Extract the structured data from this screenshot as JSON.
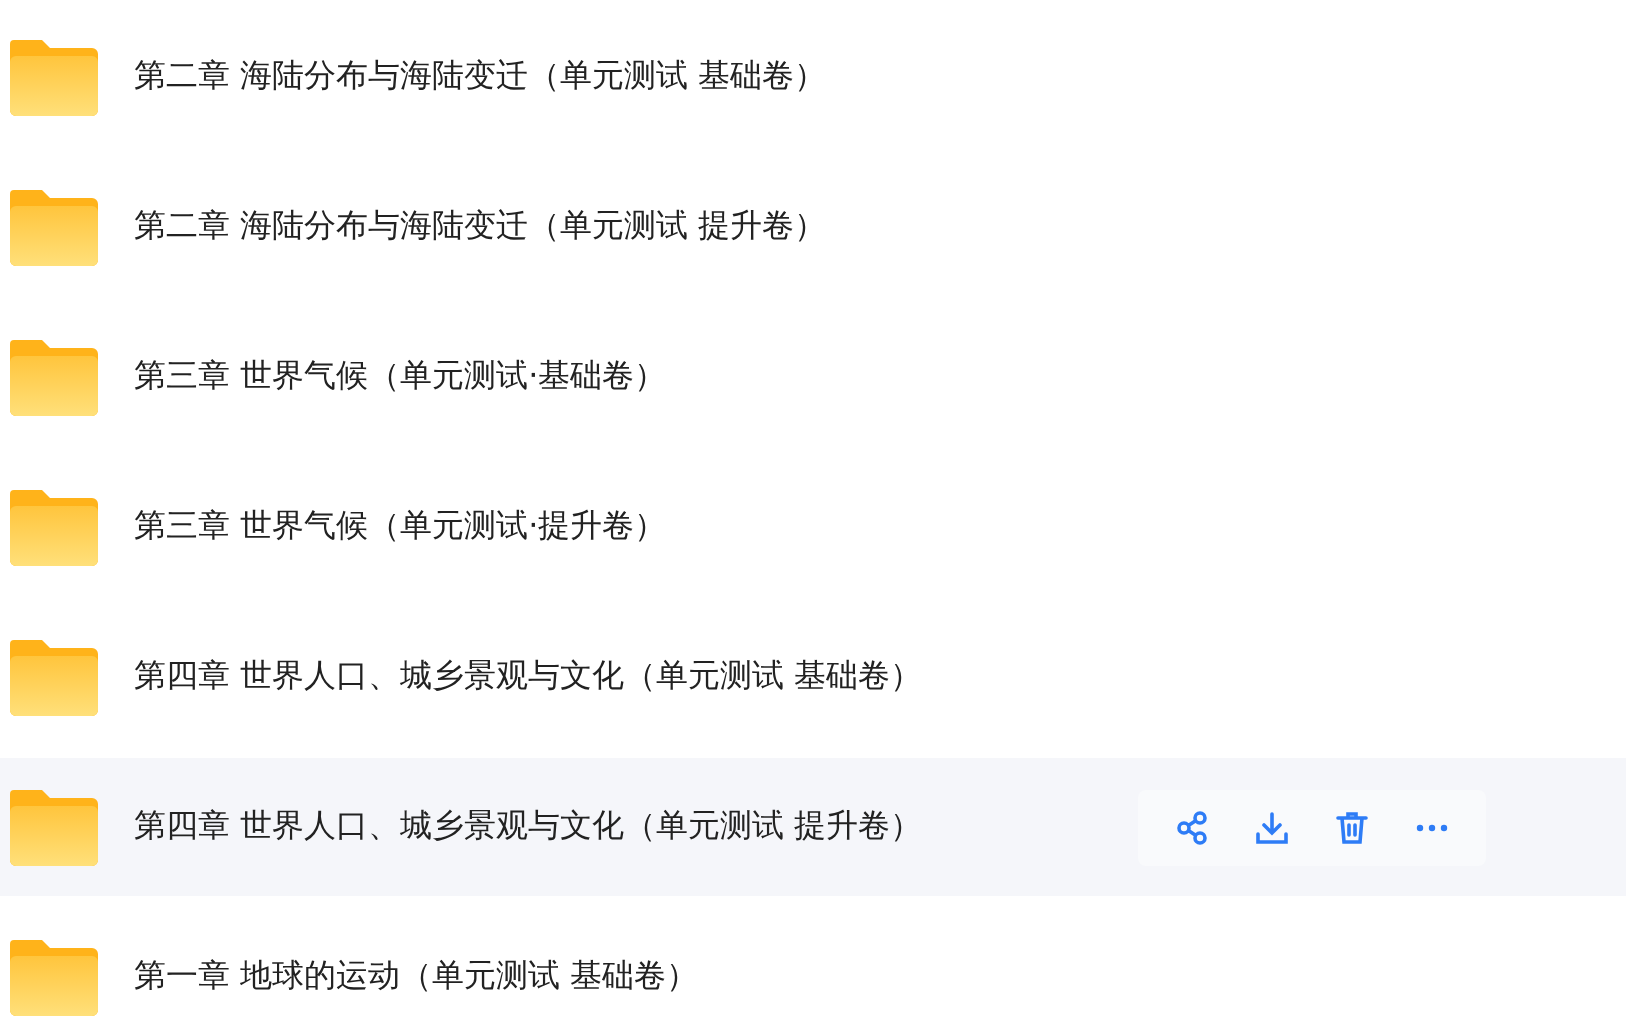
{
  "files": [
    {
      "name": "第二章 海陆分布与海陆变迁（单元测试 基础卷）",
      "hovered": false
    },
    {
      "name": "第二章 海陆分布与海陆变迁（单元测试 提升卷）",
      "hovered": false
    },
    {
      "name": "第三章 世界气候（单元测试·基础卷）",
      "hovered": false
    },
    {
      "name": "第三章 世界气候（单元测试·提升卷）",
      "hovered": false
    },
    {
      "name": "第四章 世界人口、城乡景观与文化（单元测试 基础卷）",
      "hovered": false
    },
    {
      "name": "第四章 世界人口、城乡景观与文化（单元测试 提升卷）",
      "hovered": true
    },
    {
      "name": "第一章 地球的运动（单元测试 基础卷）",
      "hovered": false
    }
  ]
}
